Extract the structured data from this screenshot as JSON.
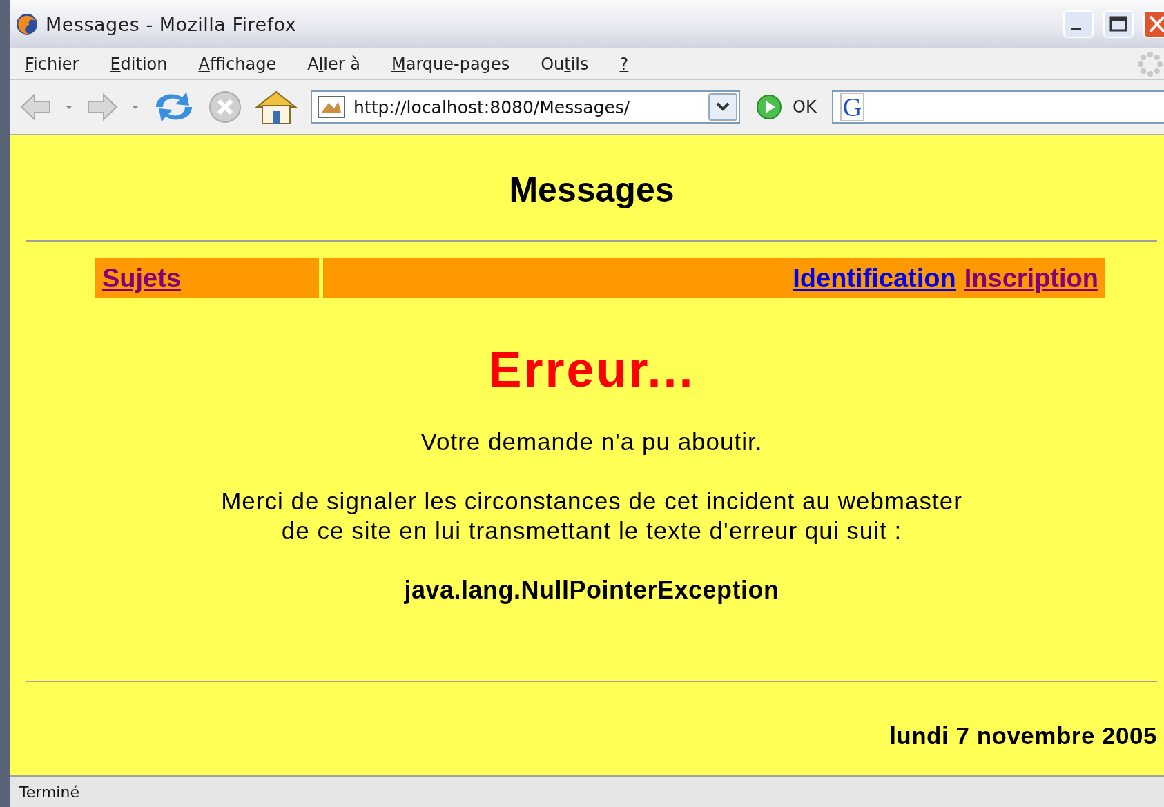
{
  "window": {
    "title": "Messages - Mozilla Firefox"
  },
  "menu": [
    {
      "key": "F",
      "after": "ichier"
    },
    {
      "key": "E",
      "after": "dition"
    },
    {
      "key": "A",
      "after": "ffichage"
    },
    {
      "before": "A",
      "key": "l",
      "after": "ler à"
    },
    {
      "key": "M",
      "after": "arque-pages"
    },
    {
      "before": "Ou",
      "key": "t",
      "after": "ils"
    },
    {
      "key": "?"
    }
  ],
  "toolbar": {
    "url": "http://localhost:8080/Messages/",
    "go_label": "OK",
    "search_engine": "G"
  },
  "page": {
    "heading": "Messages",
    "nav_left": [
      {
        "label": "Sujets",
        "visited": true
      }
    ],
    "nav_right": [
      {
        "label": "Identification",
        "visited": false
      },
      {
        "label": "Inscription",
        "visited": true
      }
    ],
    "error_title": "Erreur...",
    "message": "Votre demande n'a pu aboutir.",
    "instructions": [
      "Merci de signaler les circonstances de cet incident au webmaster",
      "de ce site en lui transmettant le texte d'erreur qui suit :"
    ],
    "exception": "java.lang.NullPointerException",
    "date": "lundi 7 novembre 2005"
  },
  "status_bar": {
    "text": "Terminé"
  }
}
